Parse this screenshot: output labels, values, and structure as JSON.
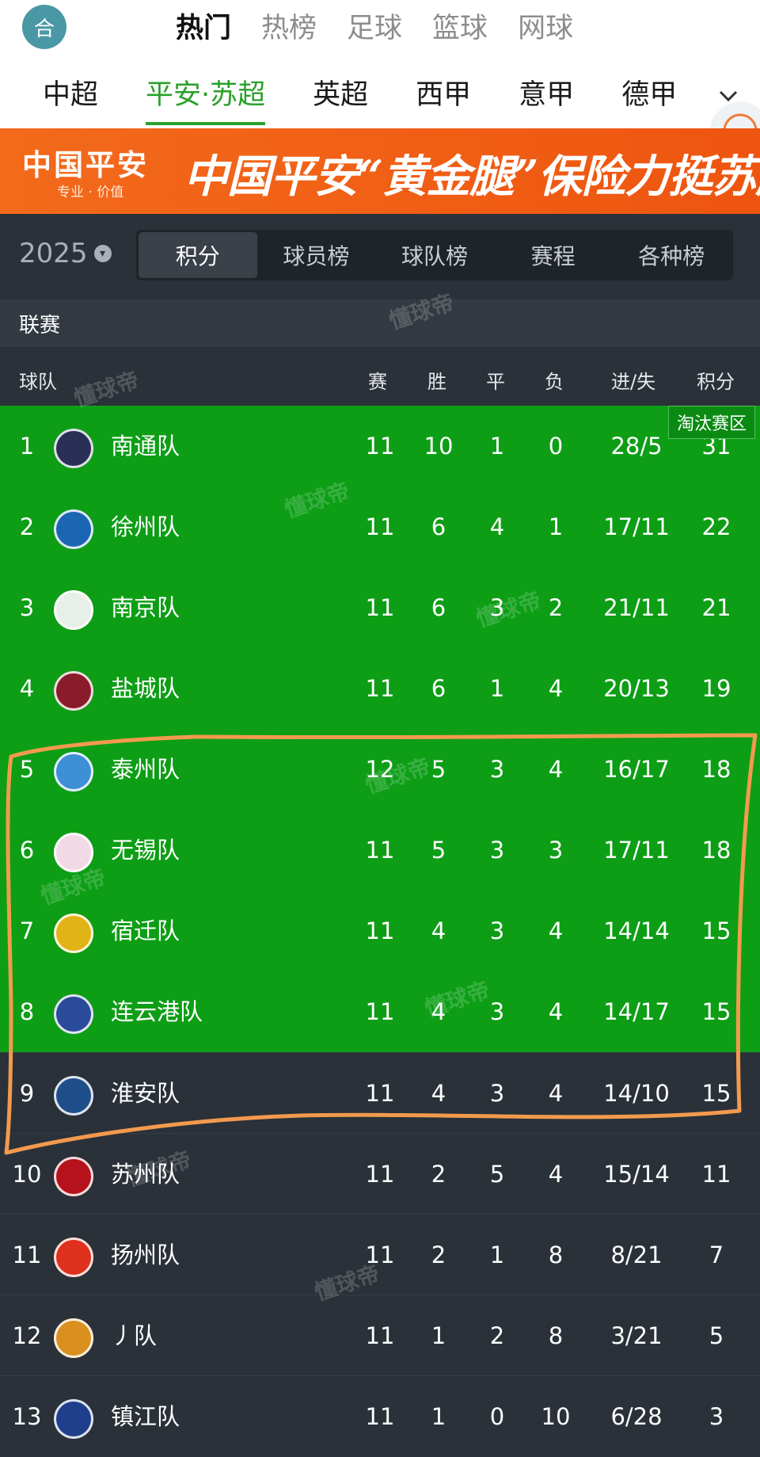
{
  "header": {
    "avatar_text": "合",
    "category_tabs": [
      "热门",
      "热榜",
      "足球",
      "篮球",
      "网球"
    ],
    "active_category": 0,
    "league_tabs": [
      "中超",
      "平安·苏超",
      "英超",
      "西甲",
      "意甲",
      "德甲"
    ],
    "active_league": 1
  },
  "banner": {
    "brand": "中国平安",
    "brand_sub": "专业 · 价值",
    "slogan": "中国平安“黄金腿”保险力挺苏超"
  },
  "season": {
    "year": "2025"
  },
  "sub_tabs": [
    "积分",
    "球员榜",
    "球队榜",
    "赛程",
    "各种榜"
  ],
  "active_sub_tab": 0,
  "section_title": "联赛",
  "columns": {
    "team": "球队",
    "played": "赛",
    "win": "胜",
    "draw": "平",
    "loss": "负",
    "goals": "进/失",
    "points": "积分"
  },
  "zone_label": "淘汰赛区",
  "watermark": "懂球帝",
  "colors": {
    "qualify_zone": "#0d9e16",
    "dark_bg": "#2b3138",
    "accent": "#2aa02a",
    "annotation": "#f39a4f"
  },
  "standings": [
    {
      "rank": "1",
      "team": "南通队",
      "logo": "nantong-logo",
      "played": "11",
      "win": "10",
      "draw": "1",
      "loss": "0",
      "goals": "28/5",
      "points": "31",
      "zone": "qualify",
      "logo_color": "#2a2f55"
    },
    {
      "rank": "2",
      "team": "徐州队",
      "logo": "xuzhou-logo",
      "played": "11",
      "win": "6",
      "draw": "4",
      "loss": "1",
      "goals": "17/11",
      "points": "22",
      "zone": "qualify",
      "logo_color": "#1a66b3"
    },
    {
      "rank": "3",
      "team": "南京队",
      "logo": "nanjing-logo",
      "played": "11",
      "win": "6",
      "draw": "3",
      "loss": "2",
      "goals": "21/11",
      "points": "21",
      "zone": "qualify",
      "logo_color": "#e8efe8"
    },
    {
      "rank": "4",
      "team": "盐城队",
      "logo": "yancheng-logo",
      "played": "11",
      "win": "6",
      "draw": "1",
      "loss": "4",
      "goals": "20/13",
      "points": "19",
      "zone": "qualify",
      "logo_color": "#8a1b2b"
    },
    {
      "rank": "5",
      "team": "泰州队",
      "logo": "taizhou-logo",
      "played": "12",
      "win": "5",
      "draw": "3",
      "loss": "4",
      "goals": "16/17",
      "points": "18",
      "zone": "qualify",
      "logo_color": "#3d8fd6"
    },
    {
      "rank": "6",
      "team": "无锡队",
      "logo": "wuxi-logo",
      "played": "11",
      "win": "5",
      "draw": "3",
      "loss": "3",
      "goals": "17/11",
      "points": "18",
      "zone": "qualify",
      "logo_color": "#f2d9e6"
    },
    {
      "rank": "7",
      "team": "宿迁队",
      "logo": "suqian-logo",
      "played": "11",
      "win": "4",
      "draw": "3",
      "loss": "4",
      "goals": "14/14",
      "points": "15",
      "zone": "qualify",
      "logo_color": "#e0b416"
    },
    {
      "rank": "8",
      "team": "连云港队",
      "logo": "lianyungang-logo",
      "played": "11",
      "win": "4",
      "draw": "3",
      "loss": "4",
      "goals": "14/17",
      "points": "15",
      "zone": "qualify",
      "logo_color": "#2a4a9a"
    },
    {
      "rank": "9",
      "team": "淮安队",
      "logo": "huaian-logo",
      "played": "11",
      "win": "4",
      "draw": "3",
      "loss": "4",
      "goals": "14/10",
      "points": "15",
      "zone": "none",
      "logo_color": "#1e4f8a"
    },
    {
      "rank": "10",
      "team": "苏州队",
      "logo": "suzhou-logo",
      "played": "11",
      "win": "2",
      "draw": "5",
      "loss": "4",
      "goals": "15/14",
      "points": "11",
      "zone": "none",
      "logo_color": "#b5121b"
    },
    {
      "rank": "11",
      "team": "扬州队",
      "logo": "yangzhou-logo",
      "played": "11",
      "win": "2",
      "draw": "1",
      "loss": "8",
      "goals": "8/21",
      "points": "7",
      "zone": "none",
      "logo_color": "#e0301e"
    },
    {
      "rank": "12",
      "team": "丿队",
      "logo": "team12-logo",
      "played": "11",
      "win": "1",
      "draw": "2",
      "loss": "8",
      "goals": "3/21",
      "points": "5",
      "zone": "none",
      "logo_color": "#d9901e"
    },
    {
      "rank": "13",
      "team": "镇江队",
      "logo": "zhenjiang-logo",
      "played": "11",
      "win": "1",
      "draw": "0",
      "loss": "10",
      "goals": "6/28",
      "points": "3",
      "zone": "none",
      "logo_color": "#1f3f8c"
    }
  ]
}
